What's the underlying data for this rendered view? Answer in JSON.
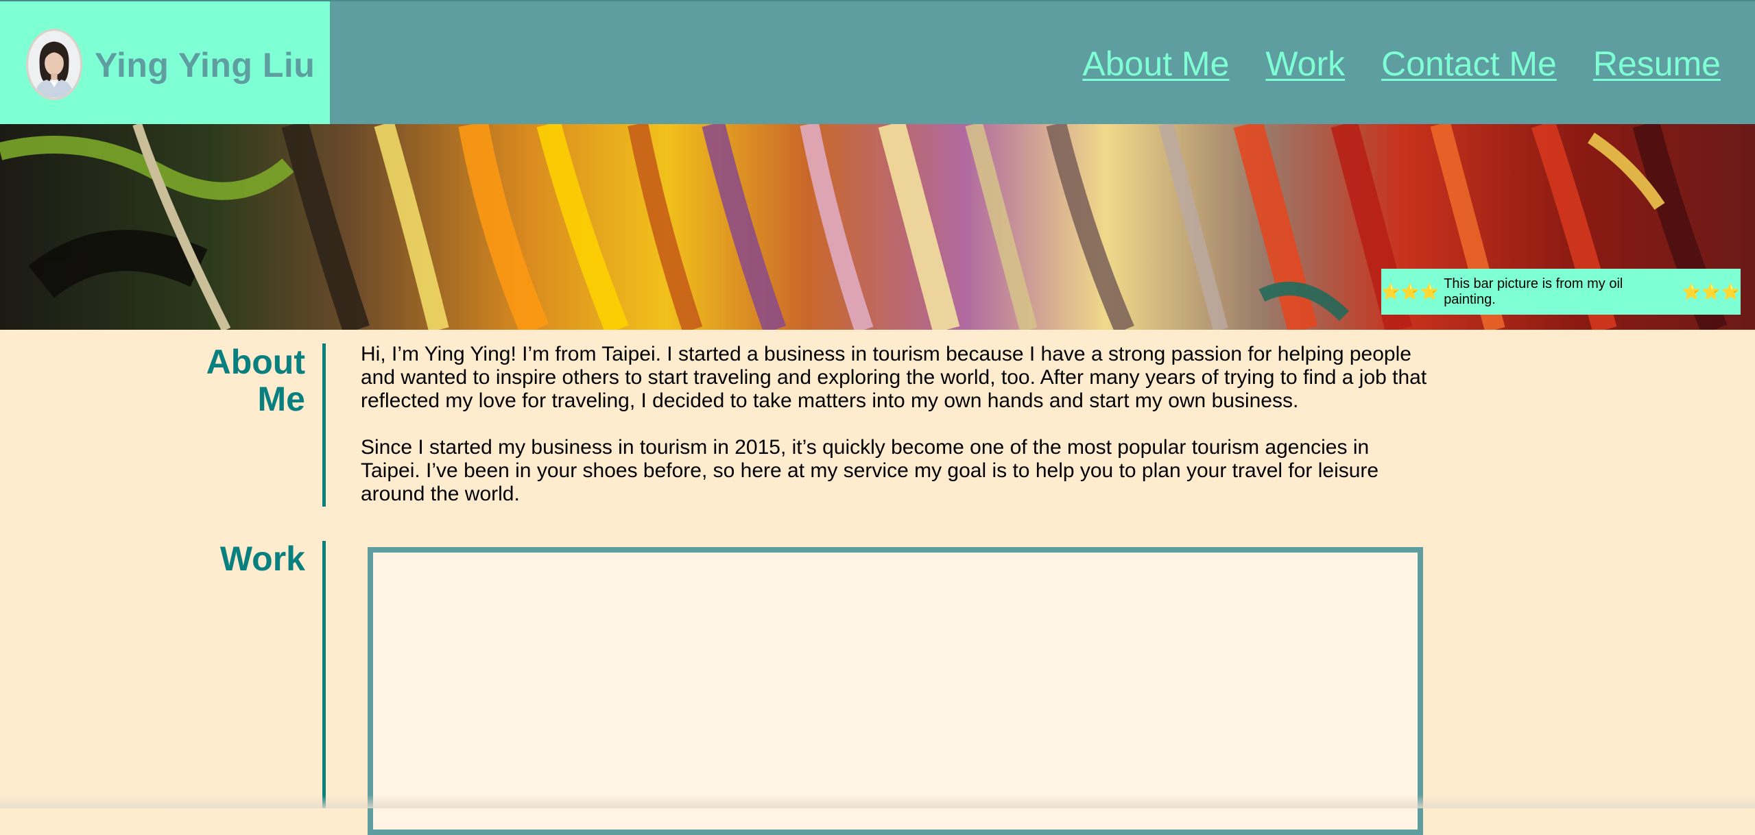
{
  "header": {
    "brand_name": "Ying Ying Liu",
    "nav": [
      {
        "label": "About Me"
      },
      {
        "label": "Work"
      },
      {
        "label": "Contact Me"
      },
      {
        "label": "Resume"
      }
    ]
  },
  "banner": {
    "caption_stars_left": "⭐⭐⭐",
    "caption_text": "This bar picture is from my oil painting.",
    "caption_stars_right": "⭐⭐⭐"
  },
  "about": {
    "title_line1": "About",
    "title_line2": "Me",
    "paragraph1": "Hi, I’m Ying Ying! I’m from Taipei. I started a business in tourism because I have a strong passion for helping people and wanted to inspire others to start traveling and exploring the world, too. After many years of trying to find a job that reflected my love for traveling, I decided to take matters into my own hands and start my own business.",
    "paragraph2": "Since I started my business in tourism in 2015, it’s quickly become one of the most popular tourism agencies in Taipei. I’ve been in your shoes before, so here at my service my goal is to help you to plan your travel for leisure around the world."
  },
  "work": {
    "title": "Work"
  },
  "colors": {
    "header_bg": "#5f9ea0",
    "brand_bg": "#7fffd4",
    "page_bg": "#ffebcd",
    "accent_teal": "#088080"
  }
}
